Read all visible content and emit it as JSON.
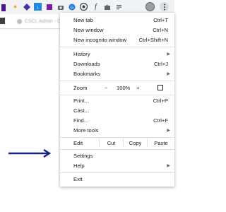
{
  "toolbar": {
    "icons": [
      "extension-badge-icon",
      "honey-icon",
      "brand-icon",
      "download-icon",
      "extension-icon",
      "camera-icon",
      "translate-icon",
      "chrome-icon",
      "function-icon",
      "puzzle-icon",
      "reading-list-icon",
      "profile-avatar-icon",
      "kebab-menu-icon"
    ]
  },
  "bookmarks": {
    "item1": "CSCL Admin - Cle"
  },
  "menu": {
    "new_tab": {
      "label": "New tab",
      "shortcut": "Ctrl+T"
    },
    "new_window": {
      "label": "New window",
      "shortcut": "Ctrl+N"
    },
    "new_incognito": {
      "label": "New incognito window",
      "shortcut": "Ctrl+Shift+N"
    },
    "history": {
      "label": "History"
    },
    "downloads": {
      "label": "Downloads",
      "shortcut": "Ctrl+J"
    },
    "bookmarks": {
      "label": "Bookmarks"
    },
    "zoom": {
      "label": "Zoom",
      "minus": "−",
      "value": "100%",
      "plus": "+"
    },
    "print": {
      "label": "Print...",
      "shortcut": "Ctrl+P"
    },
    "cast": {
      "label": "Cast..."
    },
    "find": {
      "label": "Find...",
      "shortcut": "Ctrl+F"
    },
    "more_tools": {
      "label": "More tools"
    },
    "edit": {
      "label": "Edit",
      "cut": "Cut",
      "copy": "Copy",
      "paste": "Paste"
    },
    "settings": {
      "label": "Settings"
    },
    "help": {
      "label": "Help"
    },
    "exit": {
      "label": "Exit"
    }
  },
  "colors": {
    "pointer_arrow": "#1a237e",
    "toolbar_bg": "#f1f3f4"
  }
}
